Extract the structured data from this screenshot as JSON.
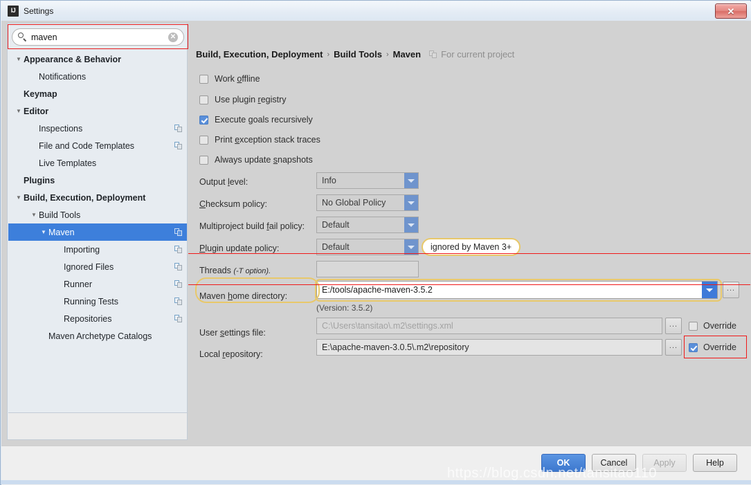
{
  "window": {
    "title": "Settings",
    "logo_icon": "intellij-idea-logo-icon",
    "close_icon": "close-icon",
    "close_label": "✕"
  },
  "search": {
    "value": "maven",
    "placeholder": "Search",
    "search_icon": "search-icon",
    "clear_icon": "clear-icon",
    "clear_label": "✕"
  },
  "sidebar": {
    "items": [
      {
        "label": "Appearance & Behavior",
        "indent": 0,
        "bold": true,
        "twisty": "▼",
        "copy": false,
        "selected": false
      },
      {
        "label": "Notifications",
        "indent": 1,
        "bold": false,
        "twisty": "",
        "copy": false,
        "selected": false
      },
      {
        "label": "Keymap",
        "indent": 0,
        "bold": true,
        "twisty": "",
        "copy": false,
        "selected": false
      },
      {
        "label": "Editor",
        "indent": 0,
        "bold": true,
        "twisty": "▼",
        "copy": false,
        "selected": false
      },
      {
        "label": "Inspections",
        "indent": 1,
        "bold": false,
        "twisty": "",
        "copy": true,
        "selected": false
      },
      {
        "label": "File and Code Templates",
        "indent": 1,
        "bold": false,
        "twisty": "",
        "copy": true,
        "selected": false
      },
      {
        "label": "Live Templates",
        "indent": 1,
        "bold": false,
        "twisty": "",
        "copy": false,
        "selected": false
      },
      {
        "label": "Plugins",
        "indent": 0,
        "bold": true,
        "twisty": "",
        "copy": false,
        "selected": false
      },
      {
        "label": "Build, Execution, Deployment",
        "indent": 0,
        "bold": true,
        "twisty": "▼",
        "copy": false,
        "selected": false
      },
      {
        "label": "Build Tools",
        "indent": 1,
        "bold": false,
        "twisty": "▼",
        "copy": false,
        "selected": false
      },
      {
        "label": "Maven",
        "indent": 2,
        "bold": false,
        "twisty": "▼",
        "copy": true,
        "selected": true
      },
      {
        "label": "Importing",
        "indent": 3,
        "bold": false,
        "twisty": "",
        "copy": true,
        "selected": false
      },
      {
        "label": "Ignored Files",
        "indent": 3,
        "bold": false,
        "twisty": "",
        "copy": true,
        "selected": false
      },
      {
        "label": "Runner",
        "indent": 3,
        "bold": false,
        "twisty": "",
        "copy": true,
        "selected": false
      },
      {
        "label": "Running Tests",
        "indent": 3,
        "bold": false,
        "twisty": "",
        "copy": true,
        "selected": false
      },
      {
        "label": "Repositories",
        "indent": 3,
        "bold": false,
        "twisty": "",
        "copy": true,
        "selected": false
      },
      {
        "label": "Maven Archetype Catalogs",
        "indent": 2,
        "bold": false,
        "twisty": "",
        "copy": false,
        "selected": false
      }
    ]
  },
  "breadcrumb": {
    "crumbs": [
      "Build, Execution, Deployment",
      "Build Tools",
      "Maven"
    ],
    "separator": "›",
    "note": "For current project",
    "note_icon": "copy-icon"
  },
  "main": {
    "checkboxes": [
      {
        "label_pre": "Work ",
        "label_key": "o",
        "label_post": "ffline",
        "checked": false
      },
      {
        "label_pre": "Use plugin ",
        "label_key": "r",
        "label_post": "egistry",
        "checked": false
      },
      {
        "label_pre": "Execute ",
        "label_key": "g",
        "label_post": "oals recursively",
        "checked": true
      },
      {
        "label_pre": "Print ",
        "label_key": "e",
        "label_post": "xception stack traces",
        "checked": false
      },
      {
        "label_pre": "Always update ",
        "label_key": "s",
        "label_post": "napshots",
        "checked": false
      }
    ],
    "output_level": {
      "label": "Output level:",
      "value": "Info"
    },
    "checksum_policy": {
      "label": "Checksum policy:",
      "value": "No Global Policy"
    },
    "multiproject_policy": {
      "label": "Multiproject build fail policy:",
      "value": "Default"
    },
    "plugin_update_policy": {
      "label": "Plugin update policy:",
      "value": "Default"
    },
    "plugin_update_tooltip": "ignored by Maven 3+",
    "threads": {
      "label": "Threads ",
      "label_italic": "(-T option).",
      "value": ""
    },
    "maven_home": {
      "label": "Maven home directory:",
      "value": "E:/tools/apache-maven-3.5.2",
      "version_note": "(Version: 3.5.2)",
      "browse_label": "..."
    },
    "user_settings": {
      "label": "User settings file:",
      "value": "C:\\Users\\tansitao\\.m2\\settings.xml",
      "browse_label": "...",
      "override_label": "Override",
      "override_checked": false
    },
    "local_repository": {
      "label": "Local repository:",
      "value": "E:\\apache-maven-3.0.5\\.m2\\repository",
      "browse_label": "...",
      "override_label": "Override",
      "override_checked": true
    }
  },
  "footer": {
    "ok": "OK",
    "cancel": "Cancel",
    "apply": "Apply",
    "help": "Help"
  },
  "watermark": "https://blog.csdn.net/tansitao110",
  "colors": {
    "accent_blue": "#3d7fdb",
    "highlight_yellow": "#e8c86a",
    "highlight_red": "#f01818",
    "sidebar_bg": "#e7ecf1",
    "panel_bg": "#d2d2d2"
  }
}
